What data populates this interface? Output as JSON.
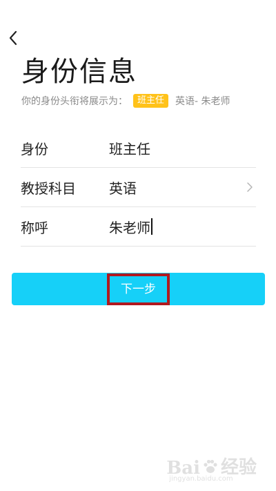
{
  "header": {
    "title": "身份信息",
    "subtitle_prefix": "你的身份头衔将展示为：",
    "badge": "班主任",
    "title_preview": "英语- 朱老师"
  },
  "form": {
    "rows": [
      {
        "label": "身份",
        "value": "班主任"
      },
      {
        "label": "教授科目",
        "value": "英语"
      },
      {
        "label": "称呼",
        "value": "朱老师"
      }
    ]
  },
  "next_button": {
    "label": "下一步"
  },
  "colors": {
    "accent": "#16d0f8",
    "badge": "#ffc21a",
    "highlight": "#b0191f"
  },
  "icons": {
    "back": "chevron-left-icon",
    "subject_arrow": "chevron-right-icon",
    "watermark": "paw-icon"
  },
  "watermark": {
    "brand_left": "Bai",
    "brand_right": "经验",
    "url": "jingyan.baidu.com"
  }
}
